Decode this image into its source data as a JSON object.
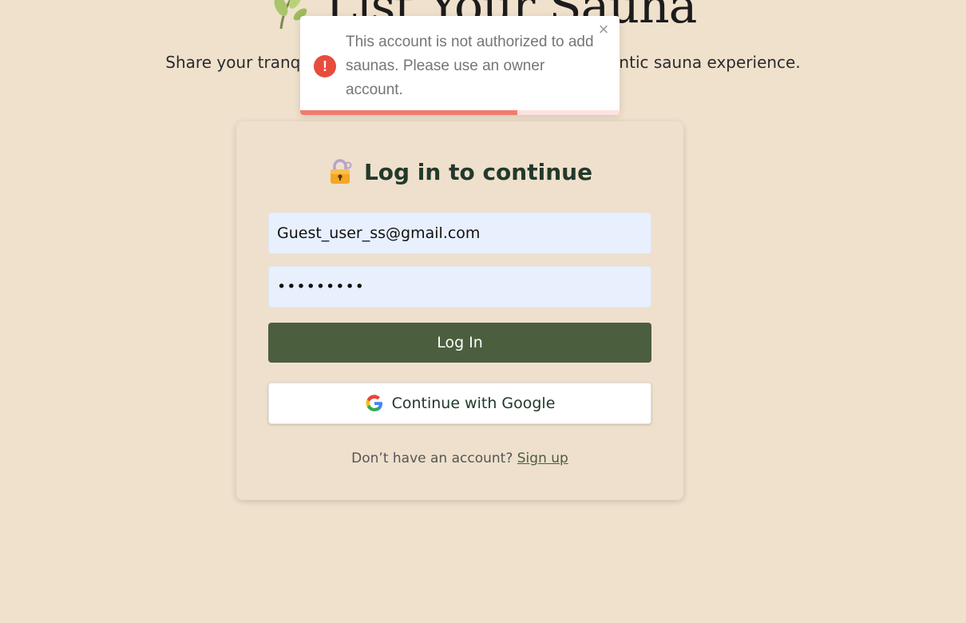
{
  "header": {
    "title": "List Your Sauna",
    "subtitle": "Share your tranquil retreat with guests seeking an authentic sauna experience."
  },
  "toast": {
    "type": "error",
    "message": "This account is not authorized to add saunas. Please use an owner account.",
    "close_symbol": "×",
    "error_symbol": "!",
    "progress_remaining": 0.68
  },
  "login": {
    "heading": "Log in to continue",
    "email_value": "Guest_user_ss@gmail.com",
    "password_value": "•••••••••",
    "login_label": "Log In",
    "google_label": "Continue with Google",
    "signup_prompt": "Don’t have an account?",
    "signup_link": "Sign up"
  },
  "colors": {
    "background": "#efe1cc",
    "primary_button": "#4b5e3d",
    "heading": "#22392b",
    "input_background": "#e8f0fe",
    "toast_error": "#e74c3c",
    "toast_progress": "#ef7d6f"
  },
  "icons": [
    "leaf-icon",
    "lock-icon",
    "error-icon",
    "close-icon",
    "google-icon"
  ]
}
